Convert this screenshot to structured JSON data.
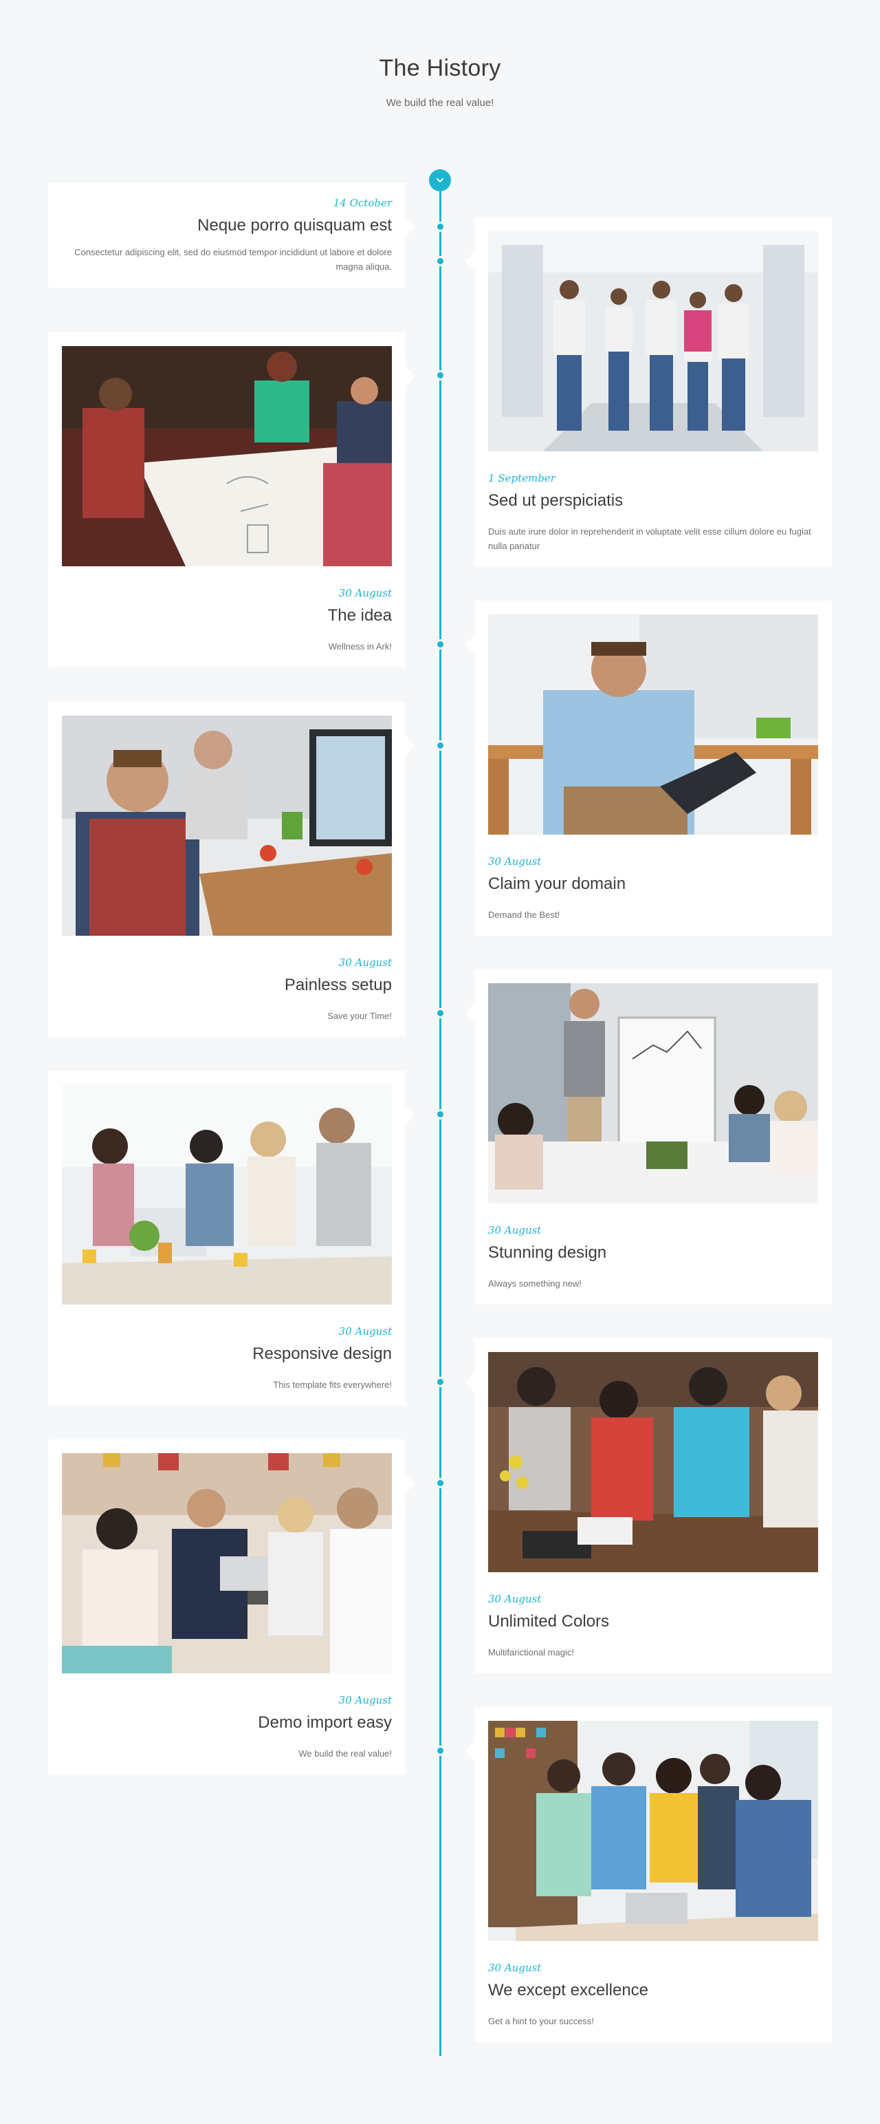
{
  "header": {
    "title": "The History",
    "subtitle": "We build the real value!"
  },
  "accent_color": "#1bb5cf",
  "top_marker_icon": "chevron-down-icon",
  "events": [
    {
      "side": "left",
      "has_photo": false,
      "date": "14 October",
      "title": "Neque porro quisquam est",
      "text": "Consectetur adipiscing elit, sed do eiusmod tempor incididunt ut labore et dolore magna aliqua."
    },
    {
      "side": "right",
      "has_photo": true,
      "photo": "people-jumping-in-hallway",
      "date": "1 September",
      "title": "Sed ut perspiciatis",
      "text": "Duis aute irure dolor in reprehenderit in voluptate velit esse cillum dolore eu fugiat nulla pariatur"
    },
    {
      "side": "left",
      "has_photo": true,
      "photo": "team-brainstorming-at-table",
      "date": "30 August",
      "title": "The idea",
      "text": "Wellness in Ark!"
    },
    {
      "side": "right",
      "has_photo": true,
      "photo": "man-on-phone-with-clipboard",
      "date": "30 August",
      "title": "Claim your domain",
      "text": "Demand the Best!"
    },
    {
      "side": "left",
      "has_photo": true,
      "photo": "smiling-team-at-desk",
      "date": "30 August",
      "title": "Painless setup",
      "text": "Save your Time!"
    },
    {
      "side": "right",
      "has_photo": true,
      "photo": "presenter-at-flipchart",
      "date": "30 August",
      "title": "Stunning design",
      "text": "Always something new!"
    },
    {
      "side": "left",
      "has_photo": true,
      "photo": "team-looking-at-laptop",
      "date": "30 August",
      "title": "Responsive design",
      "text": "This template fits everywhere!"
    },
    {
      "side": "right",
      "has_photo": true,
      "photo": "friends-with-smartphones",
      "date": "30 August",
      "title": "Unlimited Colors",
      "text": "Multifarictional magic!"
    },
    {
      "side": "left",
      "has_photo": true,
      "photo": "business-meeting-in-cafe",
      "date": "30 August",
      "title": "Demo import easy",
      "text": "We build the real value!"
    },
    {
      "side": "right",
      "has_photo": true,
      "photo": "team-around-laptop",
      "date": "30 August",
      "title": "We except excellence",
      "text": "Get a hint to your success!"
    }
  ]
}
